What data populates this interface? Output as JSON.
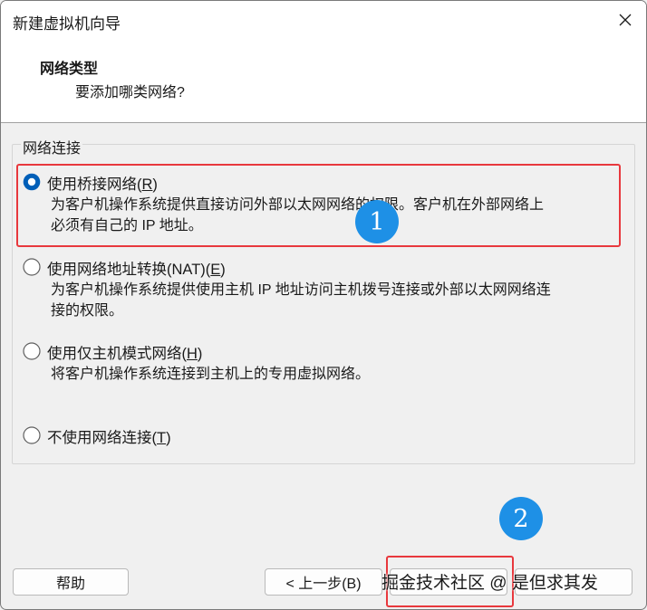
{
  "window": {
    "title": "新建虚拟机向导"
  },
  "header": {
    "title": "网络类型",
    "subtitle": "要添加哪类网络?"
  },
  "group": {
    "label": "网络连接"
  },
  "options": [
    {
      "label": "使用桥接网络",
      "accel_open": "(",
      "accel": "R",
      "accel_close": ")",
      "checked": true,
      "desc_line1": "为客户机操作系统提供直接访问外部以太网网络的权限。客户机在外部网络上",
      "desc_line2": "必须有自己的 IP 地址。"
    },
    {
      "label": "使用网络地址转换(NAT)",
      "accel_open": "(",
      "accel": "E",
      "accel_close": ")",
      "checked": false,
      "desc_line1": "为客户机操作系统提供使用主机 IP 地址访问主机拨号连接或外部以太网网络连",
      "desc_line2": "接的权限。"
    },
    {
      "label": "使用仅主机模式网络",
      "accel_open": "(",
      "accel": "H",
      "accel_close": ")",
      "checked": false,
      "desc_line1": "将客户机操作系统连接到主机上的专用虚拟网络。",
      "desc_line2": ""
    },
    {
      "label": "不使用网络连接",
      "accel_open": "(",
      "accel": "T",
      "accel_close": ")",
      "checked": false,
      "desc_line1": "",
      "desc_line2": ""
    }
  ],
  "buttons": {
    "help": "帮助",
    "back": "< 上一步(B)"
  },
  "annotations": {
    "badge1": "1",
    "badge2": "2",
    "highlight_color": "#e8383d",
    "badge_color": "#1e90e6"
  },
  "watermark": "掘金技术社区 @ 是但求其发"
}
